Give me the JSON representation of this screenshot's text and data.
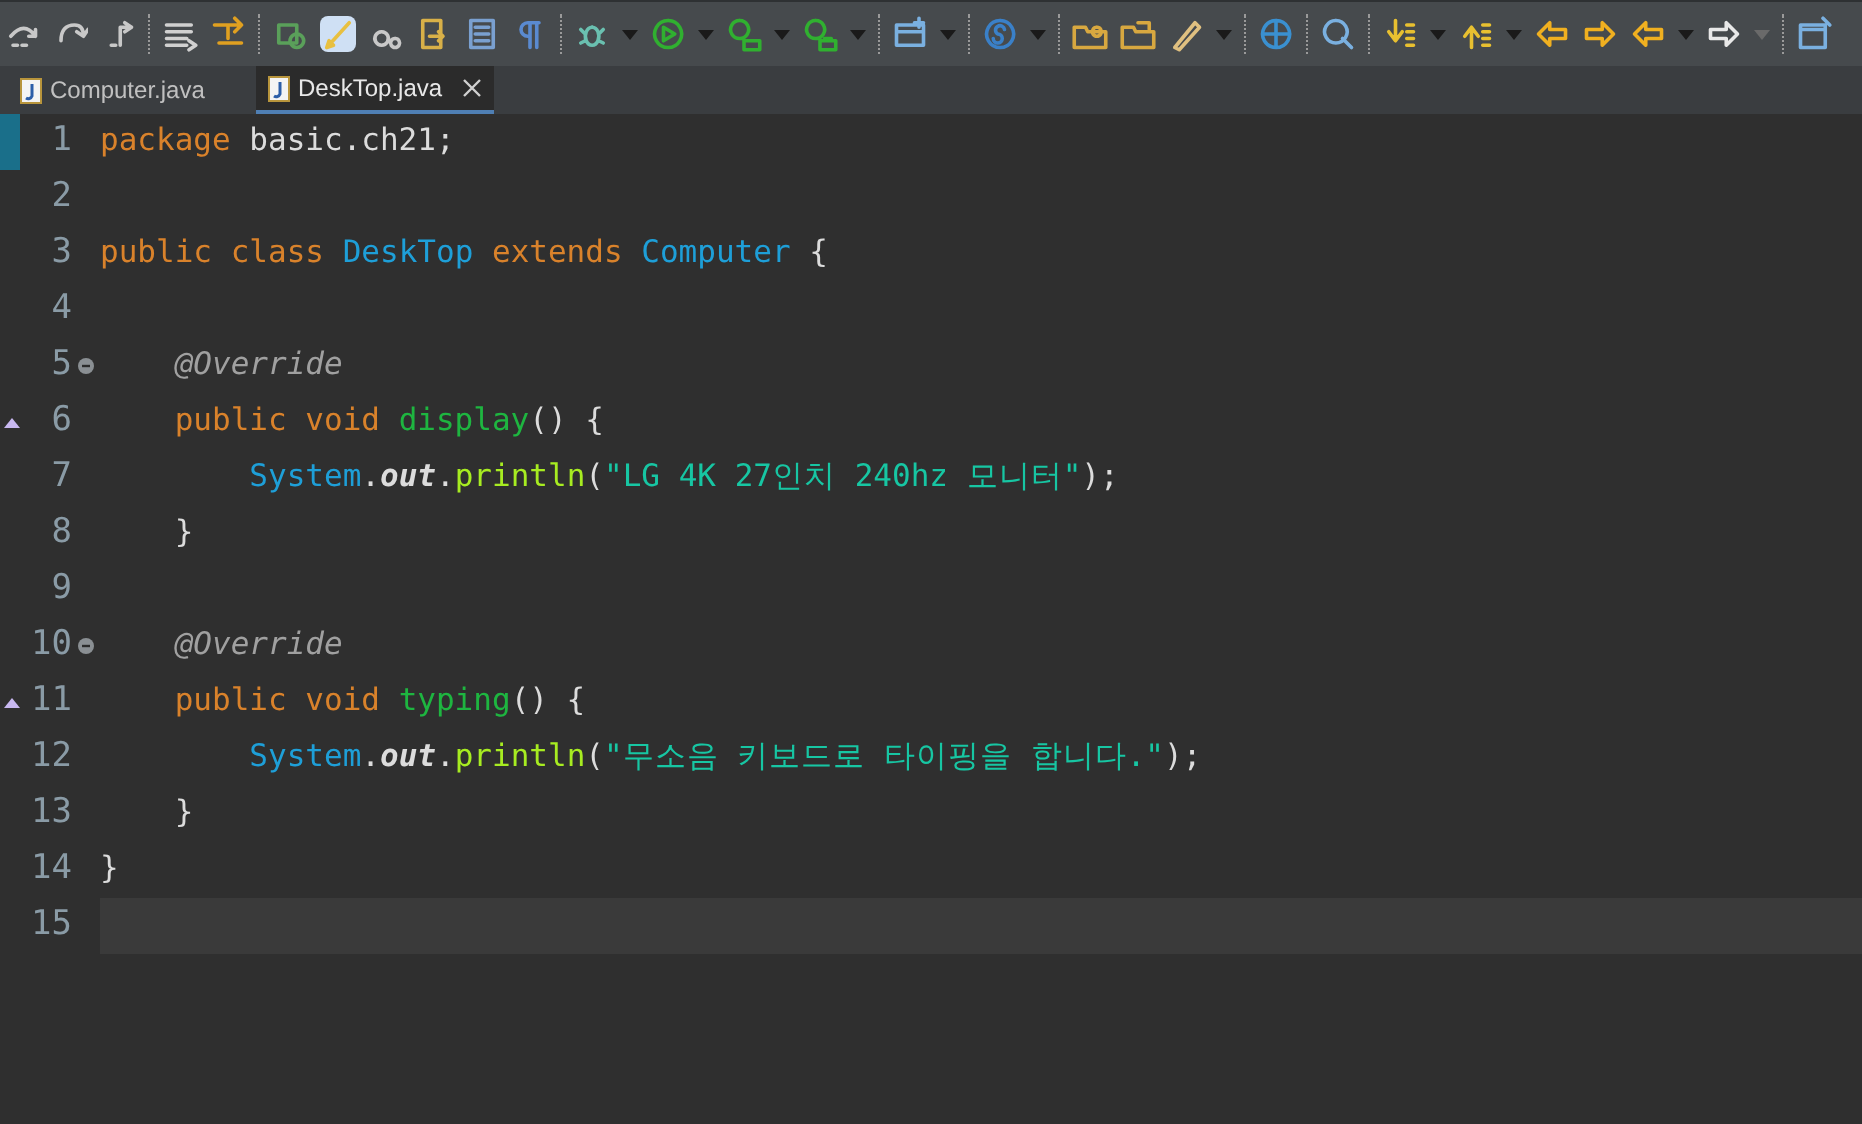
{
  "tabs": [
    {
      "label": "Computer.java",
      "selected": false
    },
    {
      "label": "DeskTop.java",
      "selected": true
    }
  ],
  "editor": {
    "lines": [
      {
        "number": "1",
        "changed": true,
        "fold": false,
        "override": false,
        "current": false,
        "tokens": [
          {
            "kind": "keyword",
            "text": "package "
          },
          {
            "kind": "plain",
            "text": "basic.ch21;"
          }
        ]
      },
      {
        "number": "2",
        "changed": false,
        "fold": false,
        "override": false,
        "current": false
      },
      {
        "number": "3",
        "changed": false,
        "fold": false,
        "override": false,
        "current": false,
        "tokens": [
          {
            "kind": "keyword",
            "text": "public class "
          },
          {
            "kind": "type",
            "text": "DeskTop "
          },
          {
            "kind": "keyword",
            "text": "extends "
          },
          {
            "kind": "type",
            "text": "Computer "
          },
          {
            "kind": "plain",
            "text": "{"
          }
        ]
      },
      {
        "number": "4",
        "changed": false,
        "fold": false,
        "override": false,
        "current": false
      },
      {
        "number": "5",
        "changed": false,
        "fold": true,
        "override": false,
        "current": false,
        "tokens": [
          {
            "kind": "annotation",
            "text": "    @Override"
          }
        ]
      },
      {
        "number": "6",
        "changed": false,
        "fold": false,
        "override": true,
        "current": false,
        "tokens": [
          {
            "kind": "keyword",
            "text": "    public void "
          },
          {
            "kind": "method",
            "text": "display"
          },
          {
            "kind": "plain",
            "text": "() {"
          }
        ]
      },
      {
        "number": "7",
        "changed": false,
        "fold": false,
        "override": false,
        "current": false,
        "tokens": [
          {
            "kind": "type",
            "text": "        System"
          },
          {
            "kind": "plain",
            "text": "."
          },
          {
            "kind": "field",
            "text": "out"
          },
          {
            "kind": "plain",
            "text": "."
          },
          {
            "kind": "call",
            "text": "println"
          },
          {
            "kind": "plain",
            "text": "("
          },
          {
            "kind": "string",
            "text": "\"LG 4K 27인치 240hz 모니터\""
          },
          {
            "kind": "plain",
            "text": ");"
          }
        ]
      },
      {
        "number": "8",
        "changed": false,
        "fold": false,
        "override": false,
        "current": false,
        "tokens": [
          {
            "kind": "plain",
            "text": "    }"
          }
        ]
      },
      {
        "number": "9",
        "changed": false,
        "fold": false,
        "override": false,
        "current": false
      },
      {
        "number": "10",
        "changed": false,
        "fold": true,
        "override": false,
        "current": false,
        "tokens": [
          {
            "kind": "annotation",
            "text": "    @Override"
          }
        ]
      },
      {
        "number": "11",
        "changed": false,
        "fold": false,
        "override": true,
        "current": false,
        "tokens": [
          {
            "kind": "keyword",
            "text": "    public void "
          },
          {
            "kind": "method",
            "text": "typing"
          },
          {
            "kind": "plain",
            "text": "() {"
          }
        ]
      },
      {
        "number": "12",
        "changed": false,
        "fold": false,
        "override": false,
        "current": false,
        "tokens": [
          {
            "kind": "type",
            "text": "        System"
          },
          {
            "kind": "plain",
            "text": "."
          },
          {
            "kind": "field",
            "text": "out"
          },
          {
            "kind": "plain",
            "text": "."
          },
          {
            "kind": "call",
            "text": "println"
          },
          {
            "kind": "plain",
            "text": "("
          },
          {
            "kind": "string",
            "text": "\"무소음 키보드로 타이핑을 합니다.\""
          },
          {
            "kind": "plain",
            "text": ");"
          }
        ]
      },
      {
        "number": "13",
        "changed": false,
        "fold": false,
        "override": false,
        "current": false,
        "tokens": [
          {
            "kind": "plain",
            "text": "    }"
          }
        ]
      },
      {
        "number": "14",
        "changed": false,
        "fold": false,
        "override": false,
        "current": false,
        "tokens": [
          {
            "kind": "plain",
            "text": "}"
          }
        ]
      },
      {
        "number": "15",
        "changed": false,
        "fold": false,
        "override": false,
        "current": true
      }
    ]
  }
}
